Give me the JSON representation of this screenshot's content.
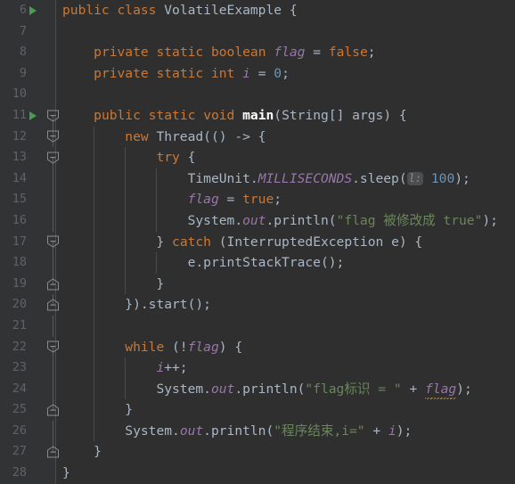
{
  "editor": {
    "theme": "darcula",
    "language": "java",
    "colors": {
      "background": "#2f2f2f",
      "gutter_background": "#313335",
      "line_number": "#606366",
      "default_text": "#a9b7c6",
      "keyword": "#cc7832",
      "string": "#6a8759",
      "number": "#6897bb",
      "field_italic": "#9876aa",
      "method": "#ffc66d",
      "run_marker_green": "#499c54",
      "parameter_hint_bg": "#4c4e50",
      "parameter_hint_text": "#8c8c8c",
      "warning_squiggle": "#a9804a"
    },
    "first_line_number": 6,
    "last_line_number": 28,
    "lines": [
      {
        "number": "6",
        "run_marker": true,
        "fold": null,
        "rail": "none",
        "indent_guides": [],
        "code": "public class VolatileExample {",
        "tokens": [
          {
            "t": "public",
            "c": "kw"
          },
          {
            "t": " ",
            "c": "plain"
          },
          {
            "t": "class",
            "c": "kw"
          },
          {
            "t": " ",
            "c": "plain"
          },
          {
            "t": "VolatileExample",
            "c": "cls"
          },
          {
            "t": " {",
            "c": "brc"
          }
        ]
      },
      {
        "number": "7",
        "run_marker": false,
        "fold": null,
        "rail": "none",
        "indent_guides": [],
        "code": "",
        "tokens": []
      },
      {
        "number": "8",
        "run_marker": false,
        "fold": null,
        "rail": "none",
        "indent_guides": [],
        "code": "    private static boolean flag = false;",
        "tokens": [
          {
            "t": "    ",
            "c": "plain"
          },
          {
            "t": "private",
            "c": "kw"
          },
          {
            "t": " ",
            "c": "plain"
          },
          {
            "t": "static",
            "c": "kw"
          },
          {
            "t": " ",
            "c": "plain"
          },
          {
            "t": "boolean",
            "c": "kw"
          },
          {
            "t": " ",
            "c": "plain"
          },
          {
            "t": "flag",
            "c": "fld"
          },
          {
            "t": " = ",
            "c": "plain"
          },
          {
            "t": "false",
            "c": "kw"
          },
          {
            "t": ";",
            "c": "plain"
          }
        ]
      },
      {
        "number": "9",
        "run_marker": false,
        "fold": null,
        "rail": "none",
        "indent_guides": [],
        "code": "    private static int i = 0;",
        "tokens": [
          {
            "t": "    ",
            "c": "plain"
          },
          {
            "t": "private",
            "c": "kw"
          },
          {
            "t": " ",
            "c": "plain"
          },
          {
            "t": "static",
            "c": "kw"
          },
          {
            "t": " ",
            "c": "plain"
          },
          {
            "t": "int",
            "c": "kw"
          },
          {
            "t": " ",
            "c": "plain"
          },
          {
            "t": "i",
            "c": "fld"
          },
          {
            "t": " = ",
            "c": "plain"
          },
          {
            "t": "0",
            "c": "num"
          },
          {
            "t": ";",
            "c": "plain"
          }
        ]
      },
      {
        "number": "10",
        "run_marker": false,
        "fold": null,
        "rail": "none",
        "indent_guides": [],
        "code": "",
        "tokens": []
      },
      {
        "number": "11",
        "run_marker": true,
        "fold": "open",
        "rail": "half-top",
        "indent_guides": [],
        "code": "    public static void main(String[] args) {",
        "tokens": [
          {
            "t": "    ",
            "c": "plain"
          },
          {
            "t": "public",
            "c": "kw"
          },
          {
            "t": " ",
            "c": "plain"
          },
          {
            "t": "static",
            "c": "kw"
          },
          {
            "t": " ",
            "c": "plain"
          },
          {
            "t": "void",
            "c": "kw"
          },
          {
            "t": " ",
            "c": "plain"
          },
          {
            "t": "main",
            "c": "mainm"
          },
          {
            "t": "(",
            "c": "brc"
          },
          {
            "t": "String",
            "c": "cls"
          },
          {
            "t": "[] ",
            "c": "plain"
          },
          {
            "t": "args",
            "c": "plain"
          },
          {
            "t": ") {",
            "c": "brc"
          }
        ]
      },
      {
        "number": "12",
        "run_marker": false,
        "fold": "open",
        "rail": "full",
        "indent_guides": [
          1
        ],
        "code": "        new Thread(() -> {",
        "tokens": [
          {
            "t": "        ",
            "c": "plain"
          },
          {
            "t": "new",
            "c": "kw"
          },
          {
            "t": " ",
            "c": "plain"
          },
          {
            "t": "Thread",
            "c": "cls"
          },
          {
            "t": "(() -> {",
            "c": "brc"
          }
        ]
      },
      {
        "number": "13",
        "run_marker": false,
        "fold": "open",
        "rail": "half-top",
        "indent_guides": [
          1,
          2
        ],
        "code": "            try {",
        "tokens": [
          {
            "t": "            ",
            "c": "plain"
          },
          {
            "t": "try",
            "c": "kw"
          },
          {
            "t": " {",
            "c": "brc"
          }
        ]
      },
      {
        "number": "14",
        "run_marker": false,
        "fold": null,
        "rail": "full",
        "indent_guides": [
          1,
          2,
          3
        ],
        "code": "                TimeUnit.MILLISECONDS.sleep( l: 100);",
        "tokens": [
          {
            "t": "                ",
            "c": "plain"
          },
          {
            "t": "TimeUnit",
            "c": "cls"
          },
          {
            "t": ".",
            "c": "plain"
          },
          {
            "t": "MILLISECONDS",
            "c": "stat"
          },
          {
            "t": ".sleep(",
            "c": "plain"
          },
          {
            "t": "l:",
            "c": "phint"
          },
          {
            "t": " ",
            "c": "plain"
          },
          {
            "t": "100",
            "c": "num"
          },
          {
            "t": ");",
            "c": "plain"
          }
        ]
      },
      {
        "number": "15",
        "run_marker": false,
        "fold": null,
        "rail": "full",
        "indent_guides": [
          1,
          2,
          3
        ],
        "code": "                flag = true;",
        "tokens": [
          {
            "t": "                ",
            "c": "plain"
          },
          {
            "t": "flag",
            "c": "fld"
          },
          {
            "t": " = ",
            "c": "plain"
          },
          {
            "t": "true",
            "c": "kw"
          },
          {
            "t": ";",
            "c": "plain"
          }
        ]
      },
      {
        "number": "16",
        "run_marker": false,
        "fold": null,
        "rail": "full",
        "indent_guides": [
          1,
          2,
          3
        ],
        "code": "                System.out.println(\"flag 被修改成 true\");",
        "tokens": [
          {
            "t": "                ",
            "c": "plain"
          },
          {
            "t": "System",
            "c": "cls"
          },
          {
            "t": ".",
            "c": "plain"
          },
          {
            "t": "out",
            "c": "stat"
          },
          {
            "t": ".println(",
            "c": "plain"
          },
          {
            "t": "\"flag 被修改成 true\"",
            "c": "str"
          },
          {
            "t": ");",
            "c": "plain"
          }
        ]
      },
      {
        "number": "17",
        "run_marker": false,
        "fold": "open",
        "rail": "half-top",
        "indent_guides": [
          1,
          2
        ],
        "code": "            } catch (InterruptedException e) {",
        "tokens": [
          {
            "t": "            }",
            "c": "brc"
          },
          {
            "t": " ",
            "c": "plain"
          },
          {
            "t": "catch",
            "c": "kw"
          },
          {
            "t": " (",
            "c": "brc"
          },
          {
            "t": "InterruptedException",
            "c": "cls"
          },
          {
            "t": " e) {",
            "c": "plain"
          }
        ]
      },
      {
        "number": "18",
        "run_marker": false,
        "fold": null,
        "rail": "full",
        "indent_guides": [
          1,
          2,
          3
        ],
        "code": "                e.printStackTrace();",
        "tokens": [
          {
            "t": "                ",
            "c": "plain"
          },
          {
            "t": "e.printStackTrace();",
            "c": "plain"
          }
        ]
      },
      {
        "number": "19",
        "run_marker": false,
        "fold": "close",
        "rail": "half-bot",
        "indent_guides": [
          1,
          2
        ],
        "code": "            }",
        "tokens": [
          {
            "t": "            }",
            "c": "brc"
          }
        ]
      },
      {
        "number": "20",
        "run_marker": false,
        "fold": "close",
        "rail": "half-bot",
        "indent_guides": [
          1
        ],
        "code": "        }).start();",
        "tokens": [
          {
            "t": "        })",
            "c": "brc"
          },
          {
            "t": ".start();",
            "c": "plain"
          }
        ]
      },
      {
        "number": "21",
        "run_marker": false,
        "fold": null,
        "rail": "full",
        "indent_guides": [
          1
        ],
        "code": "",
        "tokens": []
      },
      {
        "number": "22",
        "run_marker": false,
        "fold": "open",
        "rail": "half-top",
        "indent_guides": [
          1
        ],
        "code": "        while (!flag) {",
        "tokens": [
          {
            "t": "        ",
            "c": "plain"
          },
          {
            "t": "while",
            "c": "kw"
          },
          {
            "t": " (!",
            "c": "brc"
          },
          {
            "t": "flag",
            "c": "fld"
          },
          {
            "t": ") {",
            "c": "brc"
          }
        ]
      },
      {
        "number": "23",
        "run_marker": false,
        "fold": null,
        "rail": "full",
        "indent_guides": [
          1,
          2
        ],
        "code": "            i++;",
        "tokens": [
          {
            "t": "            ",
            "c": "plain"
          },
          {
            "t": "i",
            "c": "fld"
          },
          {
            "t": "++;",
            "c": "plain"
          }
        ]
      },
      {
        "number": "24",
        "run_marker": false,
        "fold": null,
        "rail": "full",
        "indent_guides": [
          1,
          2
        ],
        "code": "            System.out.println(\"flag标识 = \" + flag);",
        "tokens": [
          {
            "t": "            ",
            "c": "plain"
          },
          {
            "t": "System",
            "c": "cls"
          },
          {
            "t": ".",
            "c": "plain"
          },
          {
            "t": "out",
            "c": "stat"
          },
          {
            "t": ".println(",
            "c": "plain"
          },
          {
            "t": "\"flag标识 = \"",
            "c": "str"
          },
          {
            "t": " + ",
            "c": "plain"
          },
          {
            "t": "flag",
            "c": "fld-squig"
          },
          {
            "t": ");",
            "c": "plain"
          }
        ]
      },
      {
        "number": "25",
        "run_marker": false,
        "fold": "close",
        "rail": "half-bot",
        "indent_guides": [
          1
        ],
        "code": "        }",
        "tokens": [
          {
            "t": "        }",
            "c": "brc"
          }
        ]
      },
      {
        "number": "26",
        "run_marker": false,
        "fold": null,
        "rail": "full",
        "indent_guides": [
          1
        ],
        "code": "        System.out.println(\"程序结束,i=\" + i);",
        "tokens": [
          {
            "t": "        ",
            "c": "plain"
          },
          {
            "t": "System",
            "c": "cls"
          },
          {
            "t": ".",
            "c": "plain"
          },
          {
            "t": "out",
            "c": "stat"
          },
          {
            "t": ".println(",
            "c": "plain"
          },
          {
            "t": "\"程序结束,i=\"",
            "c": "str"
          },
          {
            "t": " + ",
            "c": "plain"
          },
          {
            "t": "i",
            "c": "fld"
          },
          {
            "t": ");",
            "c": "plain"
          }
        ]
      },
      {
        "number": "27",
        "run_marker": false,
        "fold": "close",
        "rail": "half-bot",
        "indent_guides": [],
        "code": "    }",
        "tokens": [
          {
            "t": "    }",
            "c": "brc"
          }
        ]
      },
      {
        "number": "28",
        "run_marker": false,
        "fold": null,
        "rail": "none",
        "indent_guides": [],
        "code": "}",
        "tokens": [
          {
            "t": "}",
            "c": "brc"
          }
        ]
      }
    ]
  }
}
